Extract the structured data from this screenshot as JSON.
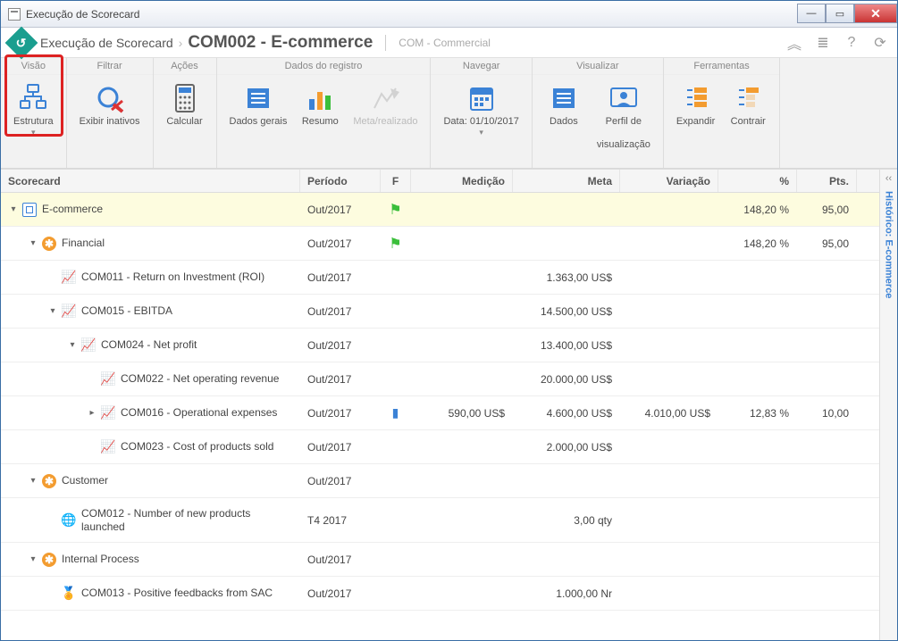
{
  "window": {
    "title": "Execução de Scorecard"
  },
  "breadcrumb": {
    "app": "Execução de Scorecard",
    "current": "COM002 - E-commerce",
    "suffix": "COM - Commercial"
  },
  "toolbar": {
    "groups": [
      {
        "label": "Visão",
        "items": [
          {
            "id": "estrutura",
            "label": "Estrutura",
            "dropdown": true
          }
        ]
      },
      {
        "label": "Filtrar",
        "items": [
          {
            "id": "exibir-inativos",
            "label": "Exibir inativos"
          }
        ]
      },
      {
        "label": "Ações",
        "items": [
          {
            "id": "calcular",
            "label": "Calcular"
          }
        ]
      },
      {
        "label": "Dados do registro",
        "items": [
          {
            "id": "dados-gerais",
            "label": "Dados gerais"
          },
          {
            "id": "resumo",
            "label": "Resumo"
          },
          {
            "id": "meta-realizado",
            "label": "Meta/realizado",
            "disabled": true
          }
        ]
      },
      {
        "label": "Navegar",
        "items": [
          {
            "id": "data",
            "label": "Data: 01/10/2017",
            "dropdown": true
          }
        ]
      },
      {
        "label": "Visualizar",
        "items": [
          {
            "id": "dados",
            "label": "Dados"
          },
          {
            "id": "perfil-vis",
            "label": "Perfil de\nvisualização"
          }
        ]
      },
      {
        "label": "Ferramentas",
        "items": [
          {
            "id": "expandir",
            "label": "Expandir"
          },
          {
            "id": "contrair",
            "label": "Contrair"
          }
        ]
      }
    ]
  },
  "columns": {
    "name": "Scorecard",
    "period": "Período",
    "f": "F",
    "med": "Medição",
    "meta": "Meta",
    "var": "Variação",
    "pct": "%",
    "pts": "Pts."
  },
  "rows": [
    {
      "indent": 0,
      "exp": "▾",
      "icon": "scorecard",
      "label": "E-commerce",
      "period": "Out/2017",
      "flag": true,
      "pct": "148,20 %",
      "pts": "95,00",
      "hl": true
    },
    {
      "indent": 1,
      "exp": "▾",
      "icon": "persp",
      "label": "Financial",
      "period": "Out/2017",
      "flag": true,
      "pct": "148,20 %",
      "pts": "95,00"
    },
    {
      "indent": 2,
      "exp": "",
      "icon": "metric",
      "label": "COM011 - Return on Investment (ROI)",
      "period": "Out/2017",
      "meta": "1.363,00 US$"
    },
    {
      "indent": 2,
      "exp": "▾",
      "icon": "metric",
      "label": "COM015 - EBITDA",
      "period": "Out/2017",
      "meta": "14.500,00 US$"
    },
    {
      "indent": 3,
      "exp": "▾",
      "icon": "metric",
      "label": "COM024 - Net profit",
      "period": "Out/2017",
      "meta": "13.400,00 US$"
    },
    {
      "indent": 4,
      "exp": "",
      "icon": "metric",
      "label": "COM022 - Net operating revenue",
      "period": "Out/2017",
      "meta": "20.000,00 US$"
    },
    {
      "indent": 4,
      "exp": "▸",
      "icon": "metric",
      "label": "COM016 - Operational expenses",
      "period": "Out/2017",
      "batt": true,
      "med": "590,00 US$",
      "meta": "4.600,00 US$",
      "var": "4.010,00 US$",
      "pct": "12,83 %",
      "pts": "10,00"
    },
    {
      "indent": 4,
      "exp": "",
      "icon": "metric",
      "label": "COM023 - Cost of products sold",
      "period": "Out/2017",
      "meta": "2.000,00 US$"
    },
    {
      "indent": 1,
      "exp": "▾",
      "icon": "persp",
      "label": "Customer",
      "period": "Out/2017"
    },
    {
      "indent": 2,
      "exp": "",
      "icon": "globe",
      "label": "COM012 - Number of new products launched",
      "period": "T4 2017",
      "meta": "3,00 qty",
      "tall": true
    },
    {
      "indent": 1,
      "exp": "▾",
      "icon": "persp",
      "label": "Internal Process",
      "period": "Out/2017"
    },
    {
      "indent": 2,
      "exp": "",
      "icon": "award",
      "label": "COM013 - Positive feedbacks from SAC",
      "period": "Out/2017",
      "meta": "1.000,00 Nr"
    }
  ],
  "sidepanel": {
    "label": "Histórico: E-commerce"
  }
}
